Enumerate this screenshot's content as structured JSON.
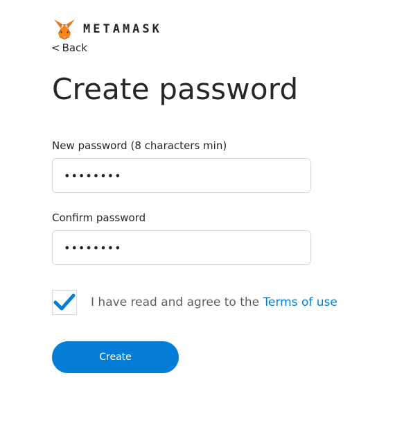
{
  "brand": {
    "logo_icon": "metamask-fox-icon",
    "wordmark": "METAMASK"
  },
  "nav": {
    "back_chevron": "<",
    "back_label": "Back"
  },
  "page": {
    "title": "Create password"
  },
  "form": {
    "new_password": {
      "label": "New password (8 characters min)",
      "value": "••••••••"
    },
    "confirm_password": {
      "label": "Confirm password",
      "value": "••••••••"
    },
    "terms": {
      "checked": true,
      "check_icon": "checkmark-icon",
      "text": "I have read and agree to the",
      "link_label": "Terms of use"
    },
    "create_button_label": "Create"
  },
  "colors": {
    "accent": "#037dd6",
    "text": "#24272a",
    "muted_text": "#5a5e63",
    "border": "#d6d9dc"
  }
}
